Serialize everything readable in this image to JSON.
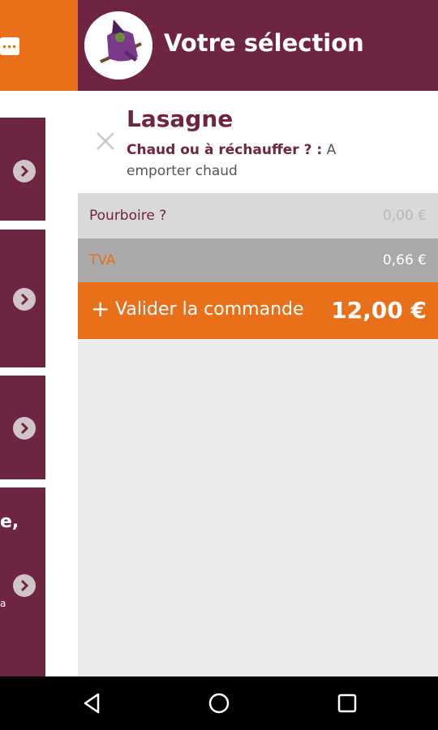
{
  "drawer": {
    "title": "Votre sélection",
    "item": {
      "name": "Lasagne",
      "option_question": "Chaud ou à réchauffer ? :",
      "option_answer": "A emporter chaud"
    },
    "tip": {
      "label": "Pourboire ?",
      "value": "0,00 €"
    },
    "vat": {
      "label": "TVA",
      "value": "0,66 €"
    },
    "validate": {
      "label": "Valider la commande",
      "total": "12,00 €"
    }
  },
  "background": {
    "partial_text": "e,",
    "partial_small": "a"
  },
  "icons": {
    "cart": "cart-icon",
    "close": "close-icon",
    "plus": "plus-icon",
    "chevron": "chevron-right-icon",
    "back": "back-icon",
    "home": "home-icon",
    "recents": "recents-icon"
  },
  "colors": {
    "brand_purple": "#6f2541",
    "brand_orange": "#e8701a",
    "panel_grey": "#ececec"
  }
}
